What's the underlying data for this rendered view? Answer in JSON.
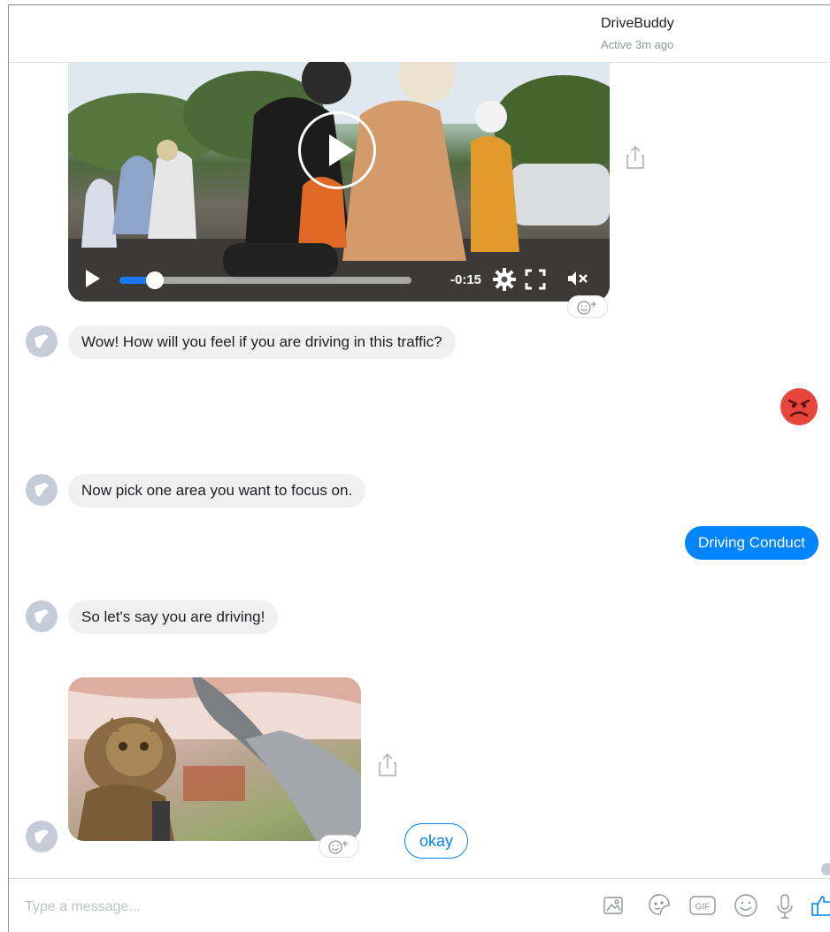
{
  "header": {
    "name": "DriveBuddy",
    "status": "Active 3m ago"
  },
  "video": {
    "time_remaining": "-0:15",
    "progress": 0.12
  },
  "messages": [
    {
      "from": "bot",
      "text": "Wow! How will you feel if you are driving in this traffic?"
    },
    {
      "from": "user",
      "type": "emoji",
      "emoji": "angry-face"
    },
    {
      "from": "bot",
      "text": "Now pick one area you want to focus on."
    },
    {
      "from": "user",
      "text": "Driving Conduct"
    },
    {
      "from": "bot",
      "text": "So let's say you are driving!"
    },
    {
      "from": "bot",
      "type": "gif",
      "subject": "cat-driving-car"
    }
  ],
  "quick_replies": [
    "okay"
  ],
  "composer": {
    "placeholder": "Type a message..."
  },
  "colors": {
    "accent": "#0084ff",
    "incoming_bubble": "#f1f0f0",
    "avatar": "#c5cbd9"
  },
  "composer_icons": [
    "photo-icon",
    "sticker-icon",
    "gif-icon",
    "emoji-icon",
    "microphone-icon",
    "like-icon"
  ]
}
